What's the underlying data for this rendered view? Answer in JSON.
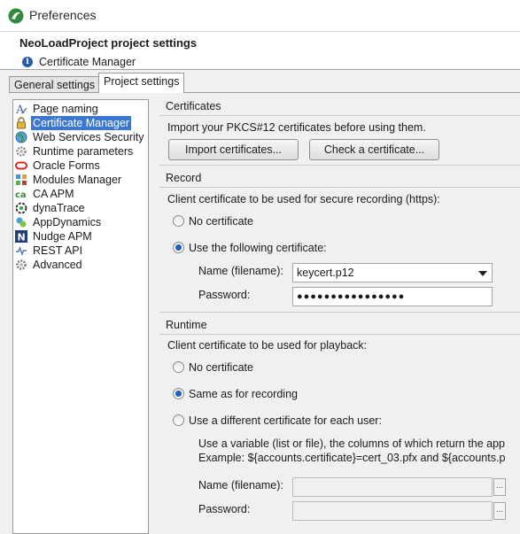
{
  "window": {
    "title": "Preferences"
  },
  "header": {
    "title": "NeoLoadProject project settings",
    "subtitle": "Certificate Manager",
    "info_icon": "info-icon"
  },
  "tabs": [
    {
      "label": "General settings"
    },
    {
      "label": "Project settings",
      "selected": true
    }
  ],
  "tree": {
    "items": [
      {
        "label": "Page naming",
        "icon": "text-a-icon"
      },
      {
        "label": "Certificate Manager",
        "icon": "lock-icon",
        "selected": true
      },
      {
        "label": "Web Services Security",
        "icon": "globe-icon"
      },
      {
        "label": "Runtime parameters",
        "icon": "gear-icon"
      },
      {
        "label": "Oracle Forms",
        "icon": "oracle-icon"
      },
      {
        "label": "Modules Manager",
        "icon": "modules-icon"
      },
      {
        "label": "CA APM",
        "icon": "ca-icon"
      },
      {
        "label": "dynaTrace",
        "icon": "dynatrace-icon"
      },
      {
        "label": "AppDynamics",
        "icon": "appdynamics-icon"
      },
      {
        "label": "Nudge APM",
        "icon": "nudge-icon"
      },
      {
        "label": "REST API",
        "icon": "rest-icon"
      },
      {
        "label": "Advanced",
        "icon": "gear-icon"
      }
    ]
  },
  "certificates": {
    "title": "Certificates",
    "description": "Import your PKCS#12 certificates before using them.",
    "import_button": "Import certificates...",
    "check_button": "Check a certificate..."
  },
  "record": {
    "title": "Record",
    "description": "Client certificate to be used for secure recording (https):",
    "option_none": "No certificate",
    "option_use": "Use the following certificate:",
    "selected_option": "use",
    "name_label": "Name (filename):",
    "name_value": "keycert.p12",
    "password_label": "Password:",
    "password_value": "●●●●●●●●●●●●●●●●"
  },
  "runtime": {
    "title": "Runtime",
    "description": "Client certificate to be used for playback:",
    "option_none": "No certificate",
    "option_same": "Same as for recording",
    "option_different": "Use a different certificate for each user:",
    "selected_option": "same",
    "hint_line1": "Use a variable (list or file), the columns of which return the app",
    "hint_line2": "Example: ${accounts.certificate}=cert_03.pfx and ${accounts.p",
    "name_label": "Name (filename):",
    "password_label": "Password:",
    "browse_label": "..."
  },
  "colors": {
    "selection": "#3a77d2",
    "radio_dot": "#1f5fb4"
  }
}
